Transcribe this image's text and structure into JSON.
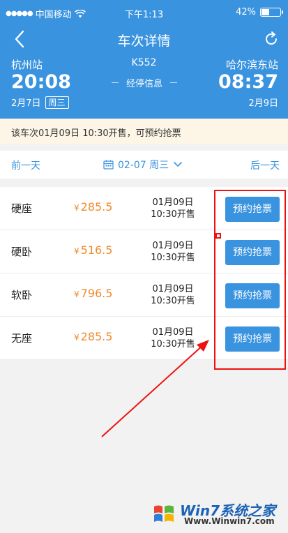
{
  "status_bar": {
    "carrier": "中国移动",
    "time": "下午1:13",
    "battery": "42%",
    "battery_level": 0.42
  },
  "header": {
    "title": "车次详情"
  },
  "trip": {
    "from_station": "杭州站",
    "to_station": "哈尔滨东站",
    "train_no": "K552",
    "depart_time": "20:08",
    "arrive_time": "08:37",
    "depart_date": "2月7日",
    "depart_weekday": "周三",
    "arrive_date": "2月9日",
    "stops_label": "经停信息"
  },
  "notice": "该车次01月09日 10:30开售，可预约抢票",
  "day_switch": {
    "prev": "前一天",
    "date": "02-07 周三",
    "next": "后一天"
  },
  "seats": [
    {
      "name": "硬座",
      "currency": "¥",
      "price": "285.5",
      "sale_date": "01月09日",
      "sale_time": "10:30开售",
      "button": "预约抢票"
    },
    {
      "name": "硬卧",
      "currency": "¥",
      "price": "516.5",
      "sale_date": "01月09日",
      "sale_time": "10:30开售",
      "button": "预约抢票"
    },
    {
      "name": "软卧",
      "currency": "¥",
      "price": "796.5",
      "sale_date": "01月09日",
      "sale_time": "10:30开售",
      "button": "预约抢票"
    },
    {
      "name": "无座",
      "currency": "¥",
      "price": "285.5",
      "sale_date": "01月09日",
      "sale_time": "10:30开售",
      "button": "预约抢票"
    }
  ],
  "watermark": {
    "title": "Win7系统之家",
    "url": "Www.Winwin7.com"
  },
  "colors": {
    "primary": "#3a93df",
    "price": "#f08a2b",
    "notice_bg": "#fdf6e6",
    "annotation": "#e11111"
  }
}
